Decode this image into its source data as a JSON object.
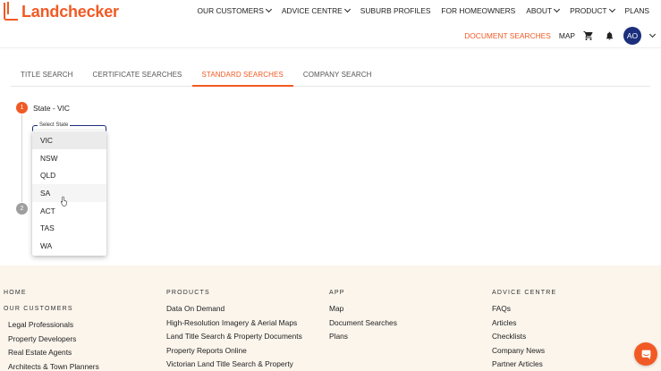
{
  "brand": {
    "name": "Landchecker",
    "color": "#f15a24"
  },
  "topnav": [
    {
      "label": "OUR CUSTOMERS",
      "has_menu": true
    },
    {
      "label": "ADVICE CENTRE",
      "has_menu": true
    },
    {
      "label": "SUBURB PROFILES",
      "has_menu": false
    },
    {
      "label": "FOR HOMEOWNERS",
      "has_menu": false
    },
    {
      "label": "ABOUT",
      "has_menu": true
    },
    {
      "label": "PRODUCT",
      "has_menu": true
    },
    {
      "label": "PLANS",
      "has_menu": false
    }
  ],
  "subnav": {
    "document_searches": "DOCUMENT SEARCHES",
    "map": "MAP",
    "cart_icon": "cart-icon",
    "bell_icon": "bell-icon",
    "avatar_initials": "AO"
  },
  "tabs": [
    {
      "label": "TITLE SEARCH",
      "active": false
    },
    {
      "label": "CERTIFICATE SEARCHES",
      "active": false
    },
    {
      "label": "STANDARD SEARCHES",
      "active": true
    },
    {
      "label": "COMPANY SEARCH",
      "active": false
    }
  ],
  "stepper": {
    "step1": {
      "number": "1",
      "label": "State - VIC"
    },
    "step2": {
      "number": "2"
    }
  },
  "state_select": {
    "label": "Select State",
    "options": [
      "VIC",
      "NSW",
      "QLD",
      "SA",
      "ACT",
      "TAS",
      "WA"
    ],
    "selected": "VIC",
    "hovered": "SA"
  },
  "footer": {
    "col1": {
      "heading": "HOME",
      "subheading": "OUR CUSTOMERS",
      "links": [
        "Legal Professionals",
        "Property Developers",
        "Real Estate Agents",
        "Architects & Town Planners"
      ]
    },
    "col2": {
      "heading": "PRODUCTS",
      "links": [
        "Data On Demand",
        "High-Resolution Imagery & Aerial Maps",
        "Land Title Search & Property Documents",
        "Property Reports Online",
        "Victorian Land Title Search & Property"
      ]
    },
    "col3": {
      "heading": "APP",
      "links": [
        "Map",
        "Document Searches",
        "Plans"
      ]
    },
    "col4": {
      "heading": "ADVICE CENTRE",
      "links": [
        "FAQs",
        "Articles",
        "Checklists",
        "Company News",
        "Partner Articles"
      ]
    }
  },
  "chat_icon": "chat-icon"
}
